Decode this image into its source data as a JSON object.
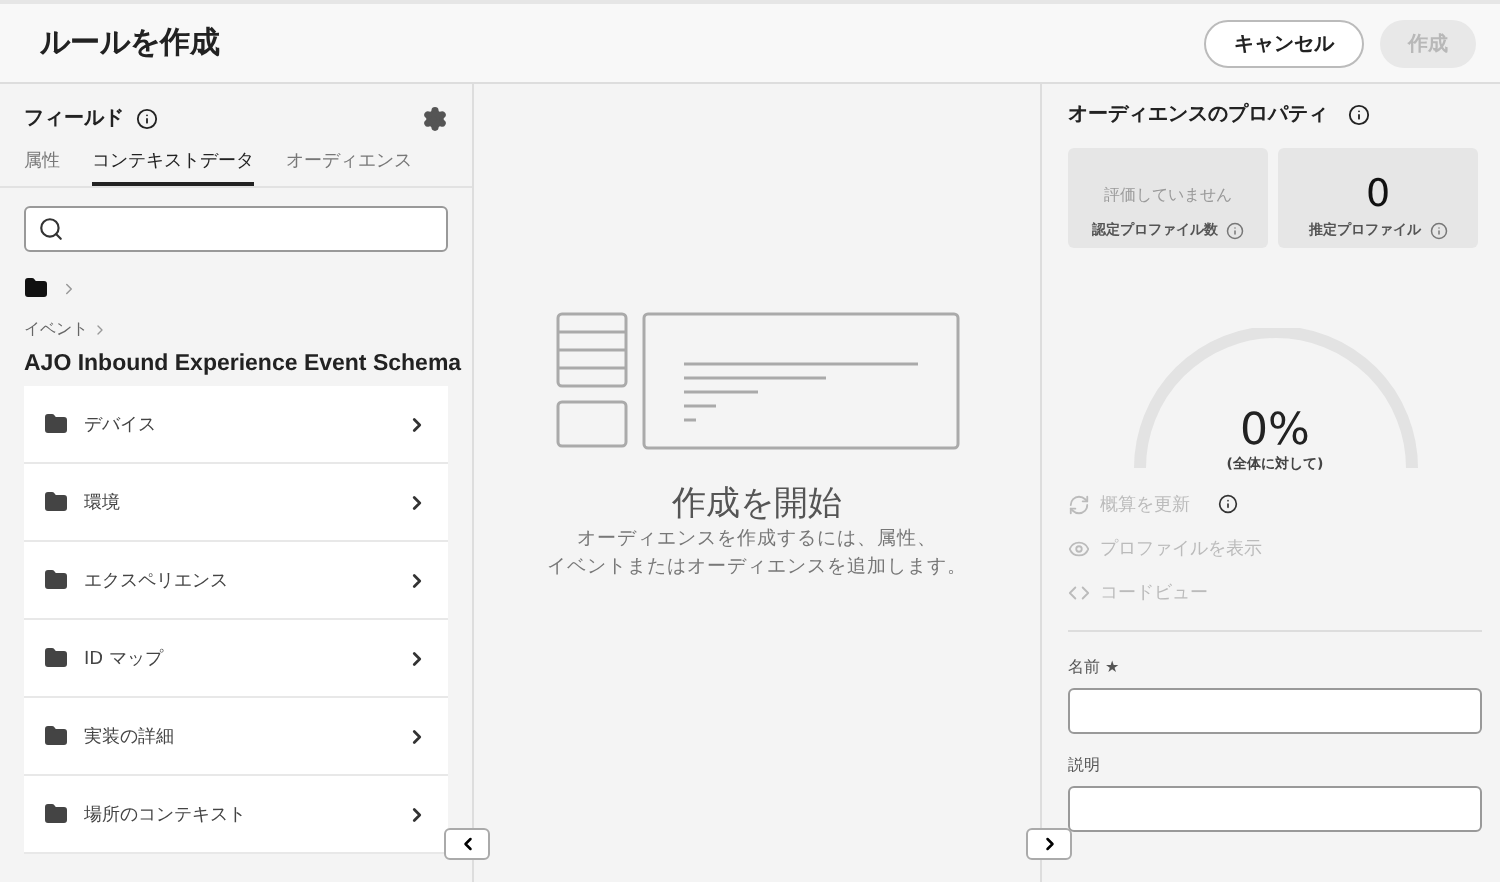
{
  "header": {
    "title": "ルールを作成",
    "buttons": [
      {
        "label": "キャンセル",
        "disabled": false
      },
      {
        "label": "作成",
        "disabled": true
      }
    ]
  },
  "fields": {
    "title": "フィールド",
    "tabs": [
      {
        "label": "属性",
        "selected": false
      },
      {
        "label": "コンテキストデータ",
        "selected": true
      },
      {
        "label": "オーディエンス",
        "selected": false
      }
    ],
    "breadcrumb": "イベント",
    "schema": "AJO Inbound Experience Event Schema",
    "items": [
      {
        "label": "デバイス"
      },
      {
        "label": "環境"
      },
      {
        "label": "エクスペリエンス"
      },
      {
        "label": "ID マップ"
      },
      {
        "label": "実装の詳細"
      },
      {
        "label": "場所のコンテキスト"
      }
    ]
  },
  "canvas": {
    "heading": "作成を開始",
    "description": [
      "オーディエンスを作成するには、属性、",
      "イベントまたはオーディエンスを追加します。"
    ]
  },
  "properties": {
    "title": "オーディエンスのプロパティ",
    "stats": [
      {
        "kind": "note",
        "value": "評価していません",
        "label": "認定プロファイル数"
      },
      {
        "kind": "number",
        "value": "0",
        "label": "推定プロファイル"
      }
    ],
    "gauge": {
      "value": "0%",
      "caption": "(全体に対して)"
    },
    "actions": [
      {
        "kind": "refresh",
        "label": "概算を更新",
        "disabled": true,
        "info": true
      },
      {
        "kind": "view",
        "label": "プロファイルを表示",
        "disabled": true,
        "info": false
      },
      {
        "kind": "code",
        "label": "コードビュー",
        "disabled": true,
        "info": false
      }
    ],
    "required_mark": "★",
    "inputs": [
      {
        "label": "名前",
        "required": true
      },
      {
        "label": "説明",
        "required": false
      }
    ]
  }
}
